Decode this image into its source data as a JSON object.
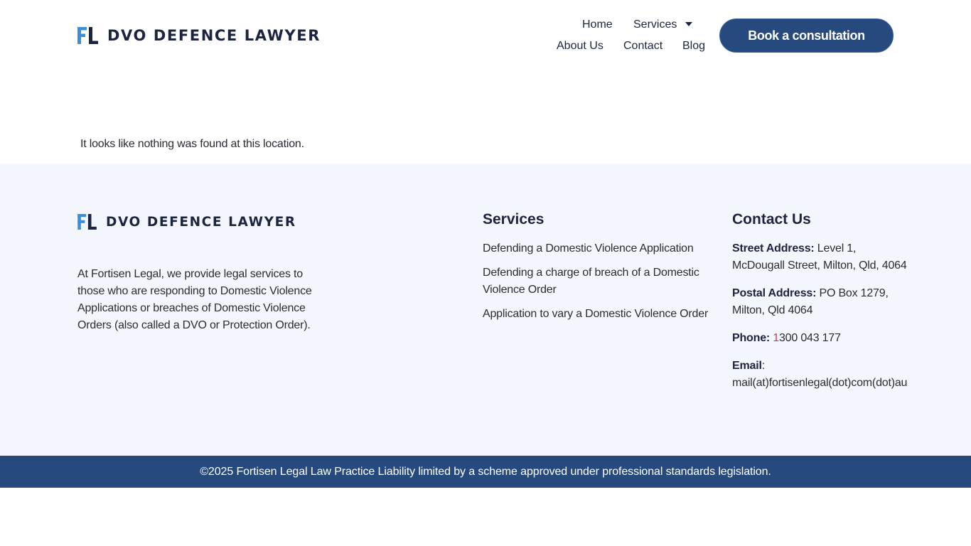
{
  "header": {
    "logo_text": "DVO DEFENCE LAWYER",
    "nav": {
      "home": "Home",
      "services": "Services",
      "about": "About Us",
      "contact": "Contact",
      "blog": "Blog"
    },
    "cta_label": "Book a consultation"
  },
  "main": {
    "not_found_text": "It looks like nothing was found at this location."
  },
  "footer": {
    "logo_text": "DVO DEFENCE LAWYER",
    "about_text": "At Fortisen Legal, we provide legal services to those who are responding to Domestic Violence Applications or breaches of Domestic Violence Orders (also called a DVO or Protection Order).",
    "services_title": "Services",
    "services": [
      "Defending a Domestic Violence Application",
      "Defending a charge of breach of a Domestic Violence Order",
      "Application to vary a Domestic Violence Order"
    ],
    "contact_title": "Contact Us",
    "contact": {
      "street_label": "Street Address:",
      "street_value": " Level 1, McDougall Street, Milton, Qld, 4064",
      "postal_label": "Postal Address:",
      "postal_value": " PO Box 1279, Milton, Qld 4064",
      "phone_label": "Phone:",
      "phone_first_digit": "1",
      "phone_rest": "300 043 177",
      "email_label": "Email",
      "email_sep": ":",
      "email_value": "mail(at)fortisenlegal(dot)com(dot)au"
    }
  },
  "bottom_bar": {
    "text": "©2025 Fortisen Legal Law Practice Liability limited by a scheme approved under professional standards legislation."
  },
  "colors": {
    "brand_navy": "#274a7e",
    "text_dark": "#1b2540",
    "logo_blue": "#3b8fd9",
    "footer_bg": "#f3f7fd",
    "phone_accent": "#c8385a"
  },
  "icons": {
    "logo_mark": "fl-monogram-icon",
    "services_caret": "caret-down-icon"
  }
}
